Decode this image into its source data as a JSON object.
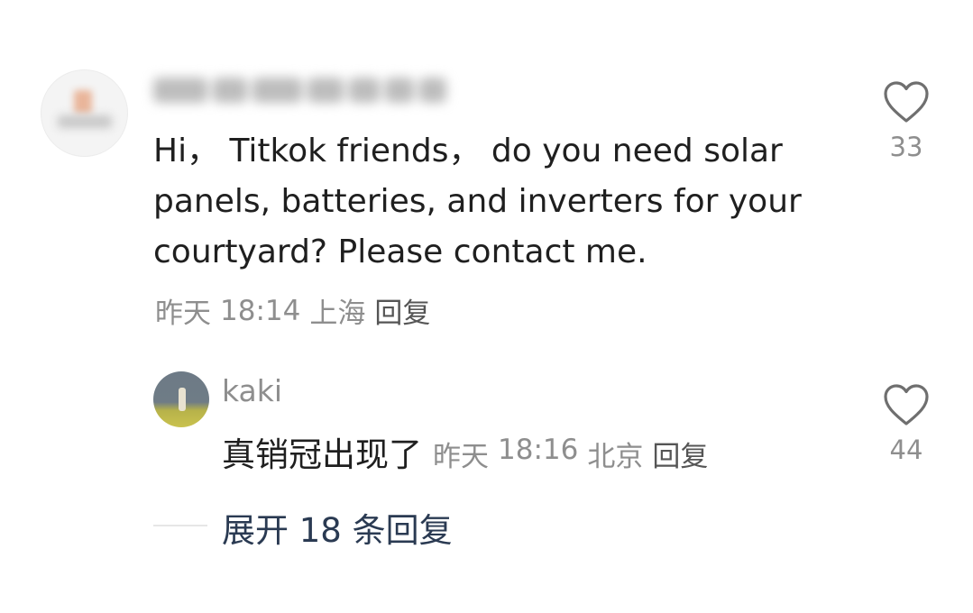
{
  "comment": {
    "text": "Hi， Titkok friends， do you need solar\npanels, batteries, and inverters for your\ncourtyard? Please contact me.",
    "date": "昨天",
    "time": "18:14",
    "location": "上海",
    "reply_label": "回复",
    "likes": "33"
  },
  "reply": {
    "username": "kaki",
    "text": "真销冠出现了",
    "date": "昨天",
    "time": "18:16",
    "location": "北京",
    "reply_label": "回复",
    "likes": "44"
  },
  "expand": {
    "label": "展开 18 条回复"
  },
  "colors": {
    "text": "#1f1f1f",
    "meta": "#8e8e8e",
    "expand_link": "#2a3a52"
  }
}
